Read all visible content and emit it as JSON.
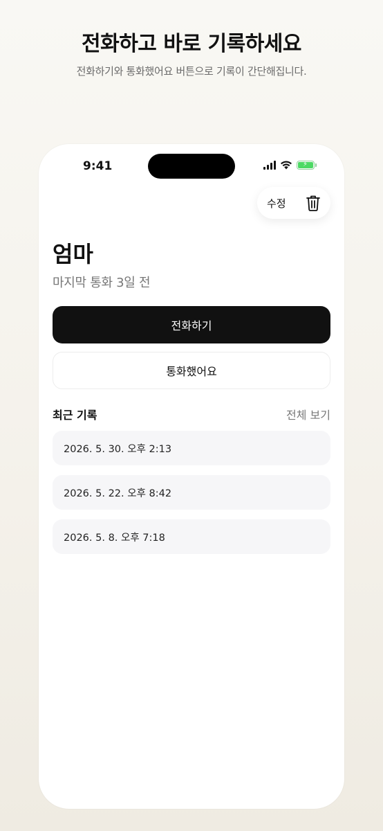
{
  "promo": {
    "title": "전화하고 바로 기록하세요",
    "subtitle": "전화하기와 통화했어요 버튼으로 기록이 간단해집니다."
  },
  "status_bar": {
    "time": "9:41",
    "battery_color": "#4cd964"
  },
  "header": {
    "edit_label": "수정",
    "delete_icon": "trash-icon"
  },
  "contact": {
    "name": "엄마",
    "last_call": "마지막 통화 3일 전"
  },
  "actions": {
    "call_label": "전화하기",
    "called_label": "통화했어요",
    "primary_color": "#111111"
  },
  "recent": {
    "title": "최근 기록",
    "view_all": "전체 보기",
    "items": [
      {
        "datetime": "2026. 5. 30. 오후 2:13"
      },
      {
        "datetime": "2026. 5. 22. 오후 8:42"
      },
      {
        "datetime": "2026. 5. 8. 오후 7:18"
      }
    ]
  }
}
